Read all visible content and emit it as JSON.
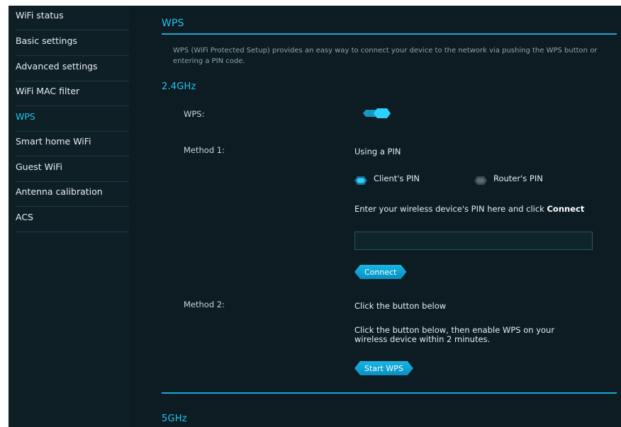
{
  "sidebar": {
    "items": [
      {
        "label": "WiFi status",
        "active": false
      },
      {
        "label": "Basic settings",
        "active": false
      },
      {
        "label": "Advanced settings",
        "active": false
      },
      {
        "label": "WiFi MAC filter",
        "active": false
      },
      {
        "label": "WPS",
        "active": true
      },
      {
        "label": "Smart home WiFi",
        "active": false
      },
      {
        "label": "Guest WiFi",
        "active": false
      },
      {
        "label": "Antenna calibration",
        "active": false
      },
      {
        "label": "ACS",
        "active": false
      }
    ]
  },
  "main": {
    "title": "WPS",
    "description": "WPS (WiFi Protected Setup) provides an easy way to connect your device to the network via pushing the WPS button or entering a PIN code.",
    "band_24": {
      "title": "2.4GHz",
      "wps_label": "WPS:",
      "wps_enabled": true,
      "method1_label": "Method 1:",
      "method1_text": "Using a PIN",
      "pin_options": [
        "Client's PIN",
        "Router's PIN"
      ],
      "pin_selected": "Client's PIN",
      "instruction_prefix": "Enter your wireless device's PIN here and click ",
      "instruction_bold": "Connect",
      "pin_value": "",
      "connect_label": "Connect",
      "method2_label": "Method 2:",
      "method2_text": "Click the button below",
      "method2_desc": "Click the button below, then enable WPS on your wireless device within 2 minutes.",
      "start_wps_label": "Start WPS"
    },
    "band_5": {
      "title": "5GHz"
    }
  },
  "colors": {
    "accent": "#21c3f0",
    "background": "#0c1c22",
    "sidebar_bg": "#0e2026",
    "divider": "#1aa7d6"
  }
}
